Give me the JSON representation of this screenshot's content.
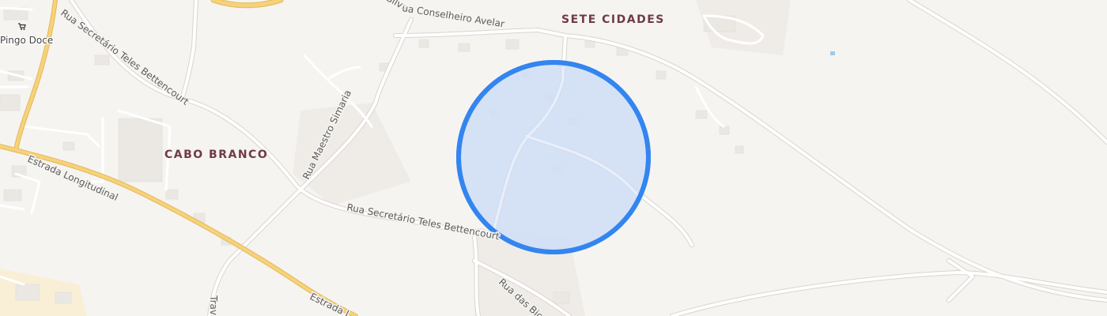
{
  "places": {
    "sete_cidades": "SETE CIDADES",
    "cabo_branco": "CABO BRANCO"
  },
  "poi": {
    "pingo_doce": "Pingo Doce",
    "icon": "shopping-cart-icon"
  },
  "streets": {
    "conselheiro_avelar": "ua Conselheiro Avelar",
    "secretario_teles_1": "Rua Secretário Teles Bettencourt",
    "secretario_teles_2": "Rua Secretário Teles Bettencourt",
    "maestro_simaria": "Rua Maestro Simaria",
    "estrada_longitudinal_1": "Estrada Longitudinal",
    "estrada_longitudinal_2": "Estrada L",
    "rua_das_bic": "Rua das Bic",
    "trav": "Trav",
    "silva": "Silva"
  },
  "overlay": {
    "fill": "#cfdef7",
    "stroke": "#3385f0"
  },
  "colors": {
    "background": "#f6f4f1",
    "main_road": "#f6d27a",
    "place_label": "#6e3b47"
  }
}
